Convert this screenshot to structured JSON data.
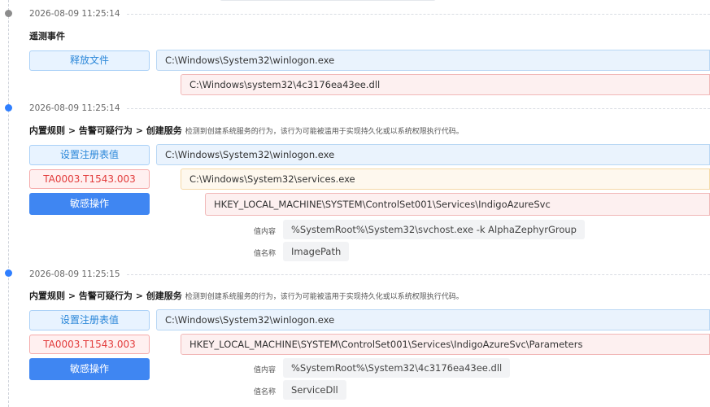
{
  "events": [
    {
      "timestamp": "2026-08-09 11:25:14",
      "title": "遥测事件",
      "action": "释放文件",
      "process_path": "C:\\Windows\\System32\\winlogon.exe",
      "target_path": "C:\\Windows\\system32\\4c3176ea43ee.dll"
    },
    {
      "timestamp": "2026-08-09 11:25:14",
      "rule_path": "内置规则 > 告警可疑行为 > 创建服务",
      "rule_desc": "检测到创建系统服务的行为，该行为可能被滥用于实现持久化或以系统权限执行代码。",
      "action": "设置注册表值",
      "attack_id": "TA0003.T1543.003",
      "sensitive_label": "敏感操作",
      "process_path": "C:\\Windows\\System32\\winlogon.exe",
      "child_path": "C:\\Windows\\System32\\services.exe",
      "registry_key": "HKEY_LOCAL_MACHINE\\SYSTEM\\ControlSet001\\Services\\IndigoAzureSvc",
      "value_content_label": "值内容",
      "value_content": "%SystemRoot%\\System32\\svchost.exe -k AlphaZephyrGroup",
      "value_name_label": "值名称",
      "value_name": "ImagePath"
    },
    {
      "timestamp": "2026-08-09 11:25:15",
      "rule_path": "内置规则 > 告警可疑行为 > 创建服务",
      "rule_desc": "检测到创建系统服务的行为，该行为可能被滥用于实现持久化或以系统权限执行代码。",
      "action": "设置注册表值",
      "attack_id": "TA0003.T1543.003",
      "sensitive_label": "敏感操作",
      "process_path": "C:\\Windows\\System32\\winlogon.exe",
      "registry_key": "HKEY_LOCAL_MACHINE\\SYSTEM\\ControlSet001\\Services\\IndigoAzureSvc\\Parameters",
      "value_content_label": "值内容",
      "value_content": "%SystemRoot%\\System32\\4c3176ea43ee.dll",
      "value_name_label": "值名称",
      "value_name": "ServiceDll"
    }
  ],
  "colors": {
    "timeline_dot_first": "#8c8c8c",
    "timeline_dot": "#2f7fff",
    "action_tag": "#2b87d9",
    "attack_tag": "#e23b3b",
    "sensitive_button": "#3f86f2"
  }
}
